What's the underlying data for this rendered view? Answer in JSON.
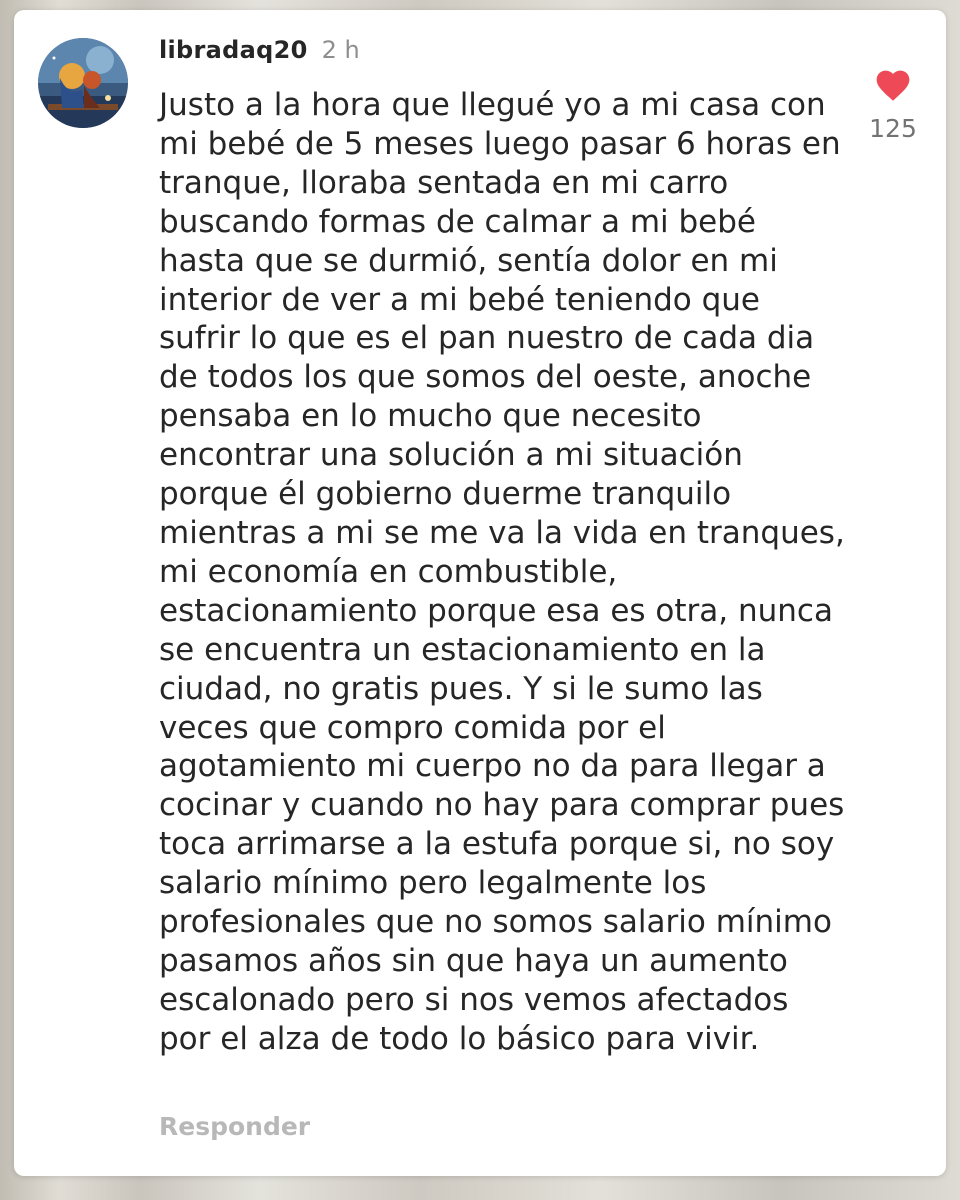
{
  "comment": {
    "username": "libradaq20",
    "time_ago": "2 h",
    "text": "Justo a la hora que llegué yo a mi casa con mi bebé de 5 meses luego pasar 6 horas en tranque, lloraba sentada en mi carro buscando formas de calmar a mi bebé hasta que se durmió, sentía dolor en mi interior de ver a mi bebé teniendo que sufrir lo que es el pan nuestro de cada dia de todos los que somos del oeste, anoche pensaba en lo mucho que necesito encontrar una solución a mi situación porque él gobierno duerme tranquilo mientras a mi se me va la vida en tranques, mi economía en combustible, estacionamiento porque esa es otra, nunca se encuentra un estacionamiento en la ciudad, no gratis pues. Y si le sumo las veces que compro comida por el agotamiento mi cuerpo no da para llegar a cocinar y cuando no hay para comprar pues toca arrimarse a la estufa porque si, no soy salario mínimo pero legalmente los profesionales que no somos salario mínimo pasamos años sin que haya un aumento escalonado pero si nos vemos afectados por el alza de todo lo básico para vivir.",
    "reply_label": "Responder",
    "like_count": "125",
    "liked": true
  },
  "icons": {
    "like": "heart-icon",
    "avatar": "avatar-image"
  },
  "colors": {
    "heart": "#ed4956",
    "username": "#262626",
    "secondary_text": "#8e8e8e",
    "reply": "#b8b8b8"
  }
}
